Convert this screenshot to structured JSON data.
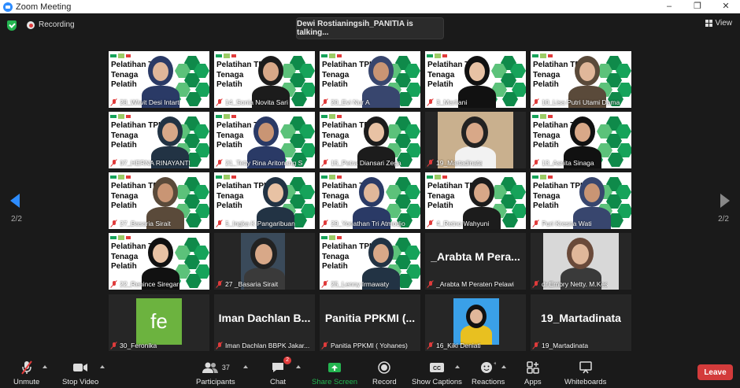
{
  "window": {
    "title": "Zoom Meeting",
    "minimize": "–",
    "maximize": "❐",
    "close": "✕"
  },
  "topbar": {
    "recording_label": "Recording",
    "talking_notice": "Dewi Rostianingsih_PANITIA is talking...",
    "view_label": "View"
  },
  "pagination": {
    "left": "2/2",
    "right": "2/2"
  },
  "slide_text": "Pelatihan TPK\nTenaga\nPelatih",
  "participants": [
    {
      "name": "28_Wiwit Desi Intarti",
      "kind": "slide"
    },
    {
      "name": "14_Sonia Novita Sari",
      "kind": "slide"
    },
    {
      "name": "20_Evi Nur A",
      "kind": "slide"
    },
    {
      "name": "3_Marliani",
      "kind": "slide"
    },
    {
      "name": "10_Lisa Putri Utami Dama",
      "kind": "slide"
    },
    {
      "name": "07_HERNA RINAYANTI",
      "kind": "slide"
    },
    {
      "name": "21_Tetty Rina Aritonang S",
      "kind": "slide"
    },
    {
      "name": "15_Petra Diansari Zega",
      "kind": "slide"
    },
    {
      "name": "19_Martadinata",
      "kind": "camera"
    },
    {
      "name": "13_Asnita Sinaga",
      "kind": "slide"
    },
    {
      "name": "27_Basaria Sirait",
      "kind": "slide"
    },
    {
      "name": "5_Ingka K Pangaribuan",
      "kind": "slide"
    },
    {
      "name": "29_Yonathan Tri Atmodjo",
      "kind": "slide"
    },
    {
      "name": "4_Retno Wahyuni",
      "kind": "slide"
    },
    {
      "name": "Puri Kresna Wati",
      "kind": "slide"
    },
    {
      "name": "22_Renince Siregar",
      "kind": "slide"
    },
    {
      "name": "27 _Basaria Sirait",
      "kind": "camera"
    },
    {
      "name": "25_Lenny Irmawaty",
      "kind": "slide"
    },
    {
      "name": "_Arabta M Peraten Pelawi",
      "kind": "text",
      "display": "_Arabta M Pera..."
    },
    {
      "name": "dr.Embry Netty. M.Kes",
      "kind": "camera"
    },
    {
      "name": "30_Feronika",
      "kind": "avatar",
      "display": "fe"
    },
    {
      "name": "Iman Dachlan BBPK Jakar...",
      "kind": "text",
      "display": "Iman Dachlan B..."
    },
    {
      "name": "Panitia PPKMI ( Yohanes)",
      "kind": "text",
      "display": "Panitia PPKMI (..."
    },
    {
      "name": "16_Kiki Deniati",
      "kind": "photo"
    },
    {
      "name": "19_Martadinata",
      "kind": "text",
      "display": "19_Martadinata"
    }
  ],
  "toolbar": {
    "unmute": "Unmute",
    "stop_video": "Stop Video",
    "participants": "Participants",
    "participants_count": "37",
    "chat": "Chat",
    "chat_badge": "2",
    "share_screen": "Share Screen",
    "record": "Record",
    "show_captions": "Show Captions",
    "reactions": "Reactions",
    "apps": "Apps",
    "whiteboards": "Whiteboards",
    "leave": "Leave"
  },
  "colors": {
    "accent": "#2d8cff",
    "slide_green": "#16a35a",
    "leave_red": "#d33b3b",
    "share_green": "#24b550"
  }
}
